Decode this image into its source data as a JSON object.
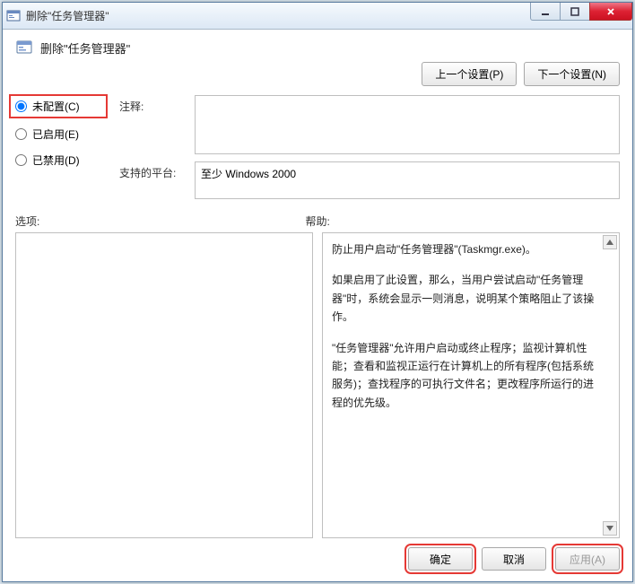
{
  "window": {
    "title": "删除\"任务管理器\""
  },
  "header": {
    "title": "删除\"任务管理器\""
  },
  "nav": {
    "prev": "上一个设置(P)",
    "next": "下一个设置(N)"
  },
  "radios": {
    "not_configured": "未配置(C)",
    "enabled": "已启用(E)",
    "disabled": "已禁用(D)",
    "selected": "not_configured"
  },
  "fields": {
    "comment_label": "注释:",
    "comment_value": "",
    "platform_label": "支持的平台:",
    "platform_value": "至少 Windows 2000"
  },
  "labels": {
    "options": "选项:",
    "help": "帮助:"
  },
  "help": {
    "p1": "防止用户启动\"任务管理器\"(Taskmgr.exe)。",
    "p2": "如果启用了此设置，那么，当用户尝试启动\"任务管理器\"时，系统会显示一则消息，说明某个策略阻止了该操作。",
    "p3": "\"任务管理器\"允许用户启动或终止程序；监视计算机性能；查看和监视正运行在计算机上的所有程序(包括系统服务)；查找程序的可执行文件名；更改程序所运行的进程的优先级。"
  },
  "footer": {
    "ok": "确定",
    "cancel": "取消",
    "apply": "应用(A)"
  }
}
